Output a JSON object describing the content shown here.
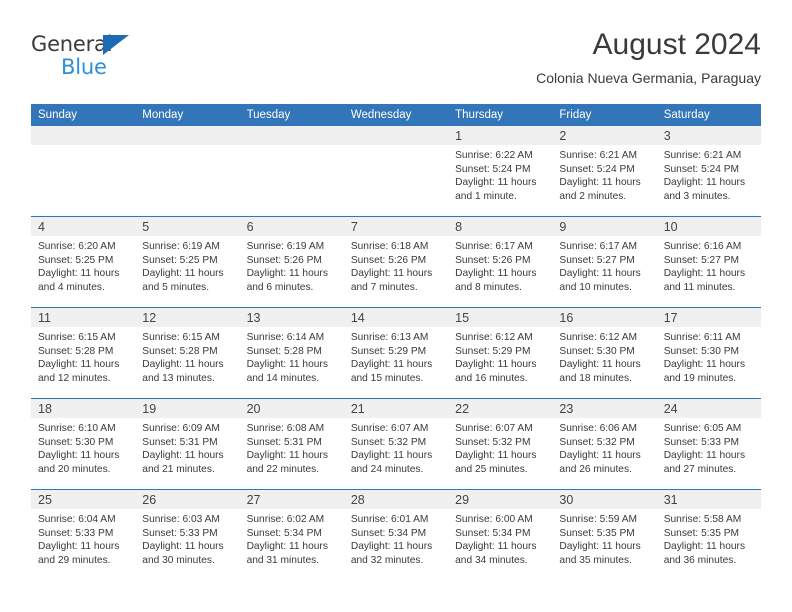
{
  "brand": {
    "name_part1": "General",
    "name_part2": "Blue",
    "triangle_color": "#1c6cb5",
    "blue_text_color": "#2f8fd6"
  },
  "header": {
    "title": "August 2024",
    "subtitle": "Colonia Nueva Germania, Paraguay",
    "header_bg_color": "#3275b8",
    "date_band_color": "#f0f0f0"
  },
  "weekdays": [
    "Sunday",
    "Monday",
    "Tuesday",
    "Wednesday",
    "Thursday",
    "Friday",
    "Saturday"
  ],
  "weeks": [
    [
      {
        "date": "",
        "lines": []
      },
      {
        "date": "",
        "lines": []
      },
      {
        "date": "",
        "lines": []
      },
      {
        "date": "",
        "lines": []
      },
      {
        "date": "1",
        "lines": [
          "Sunrise: 6:22 AM",
          "Sunset: 5:24 PM",
          "Daylight: 11 hours",
          "and 1 minute."
        ]
      },
      {
        "date": "2",
        "lines": [
          "Sunrise: 6:21 AM",
          "Sunset: 5:24 PM",
          "Daylight: 11 hours",
          "and 2 minutes."
        ]
      },
      {
        "date": "3",
        "lines": [
          "Sunrise: 6:21 AM",
          "Sunset: 5:24 PM",
          "Daylight: 11 hours",
          "and 3 minutes."
        ]
      }
    ],
    [
      {
        "date": "4",
        "lines": [
          "Sunrise: 6:20 AM",
          "Sunset: 5:25 PM",
          "Daylight: 11 hours",
          "and 4 minutes."
        ]
      },
      {
        "date": "5",
        "lines": [
          "Sunrise: 6:19 AM",
          "Sunset: 5:25 PM",
          "Daylight: 11 hours",
          "and 5 minutes."
        ]
      },
      {
        "date": "6",
        "lines": [
          "Sunrise: 6:19 AM",
          "Sunset: 5:26 PM",
          "Daylight: 11 hours",
          "and 6 minutes."
        ]
      },
      {
        "date": "7",
        "lines": [
          "Sunrise: 6:18 AM",
          "Sunset: 5:26 PM",
          "Daylight: 11 hours",
          "and 7 minutes."
        ]
      },
      {
        "date": "8",
        "lines": [
          "Sunrise: 6:17 AM",
          "Sunset: 5:26 PM",
          "Daylight: 11 hours",
          "and 8 minutes."
        ]
      },
      {
        "date": "9",
        "lines": [
          "Sunrise: 6:17 AM",
          "Sunset: 5:27 PM",
          "Daylight: 11 hours",
          "and 10 minutes."
        ]
      },
      {
        "date": "10",
        "lines": [
          "Sunrise: 6:16 AM",
          "Sunset: 5:27 PM",
          "Daylight: 11 hours",
          "and 11 minutes."
        ]
      }
    ],
    [
      {
        "date": "11",
        "lines": [
          "Sunrise: 6:15 AM",
          "Sunset: 5:28 PM",
          "Daylight: 11 hours",
          "and 12 minutes."
        ]
      },
      {
        "date": "12",
        "lines": [
          "Sunrise: 6:15 AM",
          "Sunset: 5:28 PM",
          "Daylight: 11 hours",
          "and 13 minutes."
        ]
      },
      {
        "date": "13",
        "lines": [
          "Sunrise: 6:14 AM",
          "Sunset: 5:28 PM",
          "Daylight: 11 hours",
          "and 14 minutes."
        ]
      },
      {
        "date": "14",
        "lines": [
          "Sunrise: 6:13 AM",
          "Sunset: 5:29 PM",
          "Daylight: 11 hours",
          "and 15 minutes."
        ]
      },
      {
        "date": "15",
        "lines": [
          "Sunrise: 6:12 AM",
          "Sunset: 5:29 PM",
          "Daylight: 11 hours",
          "and 16 minutes."
        ]
      },
      {
        "date": "16",
        "lines": [
          "Sunrise: 6:12 AM",
          "Sunset: 5:30 PM",
          "Daylight: 11 hours",
          "and 18 minutes."
        ]
      },
      {
        "date": "17",
        "lines": [
          "Sunrise: 6:11 AM",
          "Sunset: 5:30 PM",
          "Daylight: 11 hours",
          "and 19 minutes."
        ]
      }
    ],
    [
      {
        "date": "18",
        "lines": [
          "Sunrise: 6:10 AM",
          "Sunset: 5:30 PM",
          "Daylight: 11 hours",
          "and 20 minutes."
        ]
      },
      {
        "date": "19",
        "lines": [
          "Sunrise: 6:09 AM",
          "Sunset: 5:31 PM",
          "Daylight: 11 hours",
          "and 21 minutes."
        ]
      },
      {
        "date": "20",
        "lines": [
          "Sunrise: 6:08 AM",
          "Sunset: 5:31 PM",
          "Daylight: 11 hours",
          "and 22 minutes."
        ]
      },
      {
        "date": "21",
        "lines": [
          "Sunrise: 6:07 AM",
          "Sunset: 5:32 PM",
          "Daylight: 11 hours",
          "and 24 minutes."
        ]
      },
      {
        "date": "22",
        "lines": [
          "Sunrise: 6:07 AM",
          "Sunset: 5:32 PM",
          "Daylight: 11 hours",
          "and 25 minutes."
        ]
      },
      {
        "date": "23",
        "lines": [
          "Sunrise: 6:06 AM",
          "Sunset: 5:32 PM",
          "Daylight: 11 hours",
          "and 26 minutes."
        ]
      },
      {
        "date": "24",
        "lines": [
          "Sunrise: 6:05 AM",
          "Sunset: 5:33 PM",
          "Daylight: 11 hours",
          "and 27 minutes."
        ]
      }
    ],
    [
      {
        "date": "25",
        "lines": [
          "Sunrise: 6:04 AM",
          "Sunset: 5:33 PM",
          "Daylight: 11 hours",
          "and 29 minutes."
        ]
      },
      {
        "date": "26",
        "lines": [
          "Sunrise: 6:03 AM",
          "Sunset: 5:33 PM",
          "Daylight: 11 hours",
          "and 30 minutes."
        ]
      },
      {
        "date": "27",
        "lines": [
          "Sunrise: 6:02 AM",
          "Sunset: 5:34 PM",
          "Daylight: 11 hours",
          "and 31 minutes."
        ]
      },
      {
        "date": "28",
        "lines": [
          "Sunrise: 6:01 AM",
          "Sunset: 5:34 PM",
          "Daylight: 11 hours",
          "and 32 minutes."
        ]
      },
      {
        "date": "29",
        "lines": [
          "Sunrise: 6:00 AM",
          "Sunset: 5:34 PM",
          "Daylight: 11 hours",
          "and 34 minutes."
        ]
      },
      {
        "date": "30",
        "lines": [
          "Sunrise: 5:59 AM",
          "Sunset: 5:35 PM",
          "Daylight: 11 hours",
          "and 35 minutes."
        ]
      },
      {
        "date": "31",
        "lines": [
          "Sunrise: 5:58 AM",
          "Sunset: 5:35 PM",
          "Daylight: 11 hours",
          "and 36 minutes."
        ]
      }
    ]
  ]
}
